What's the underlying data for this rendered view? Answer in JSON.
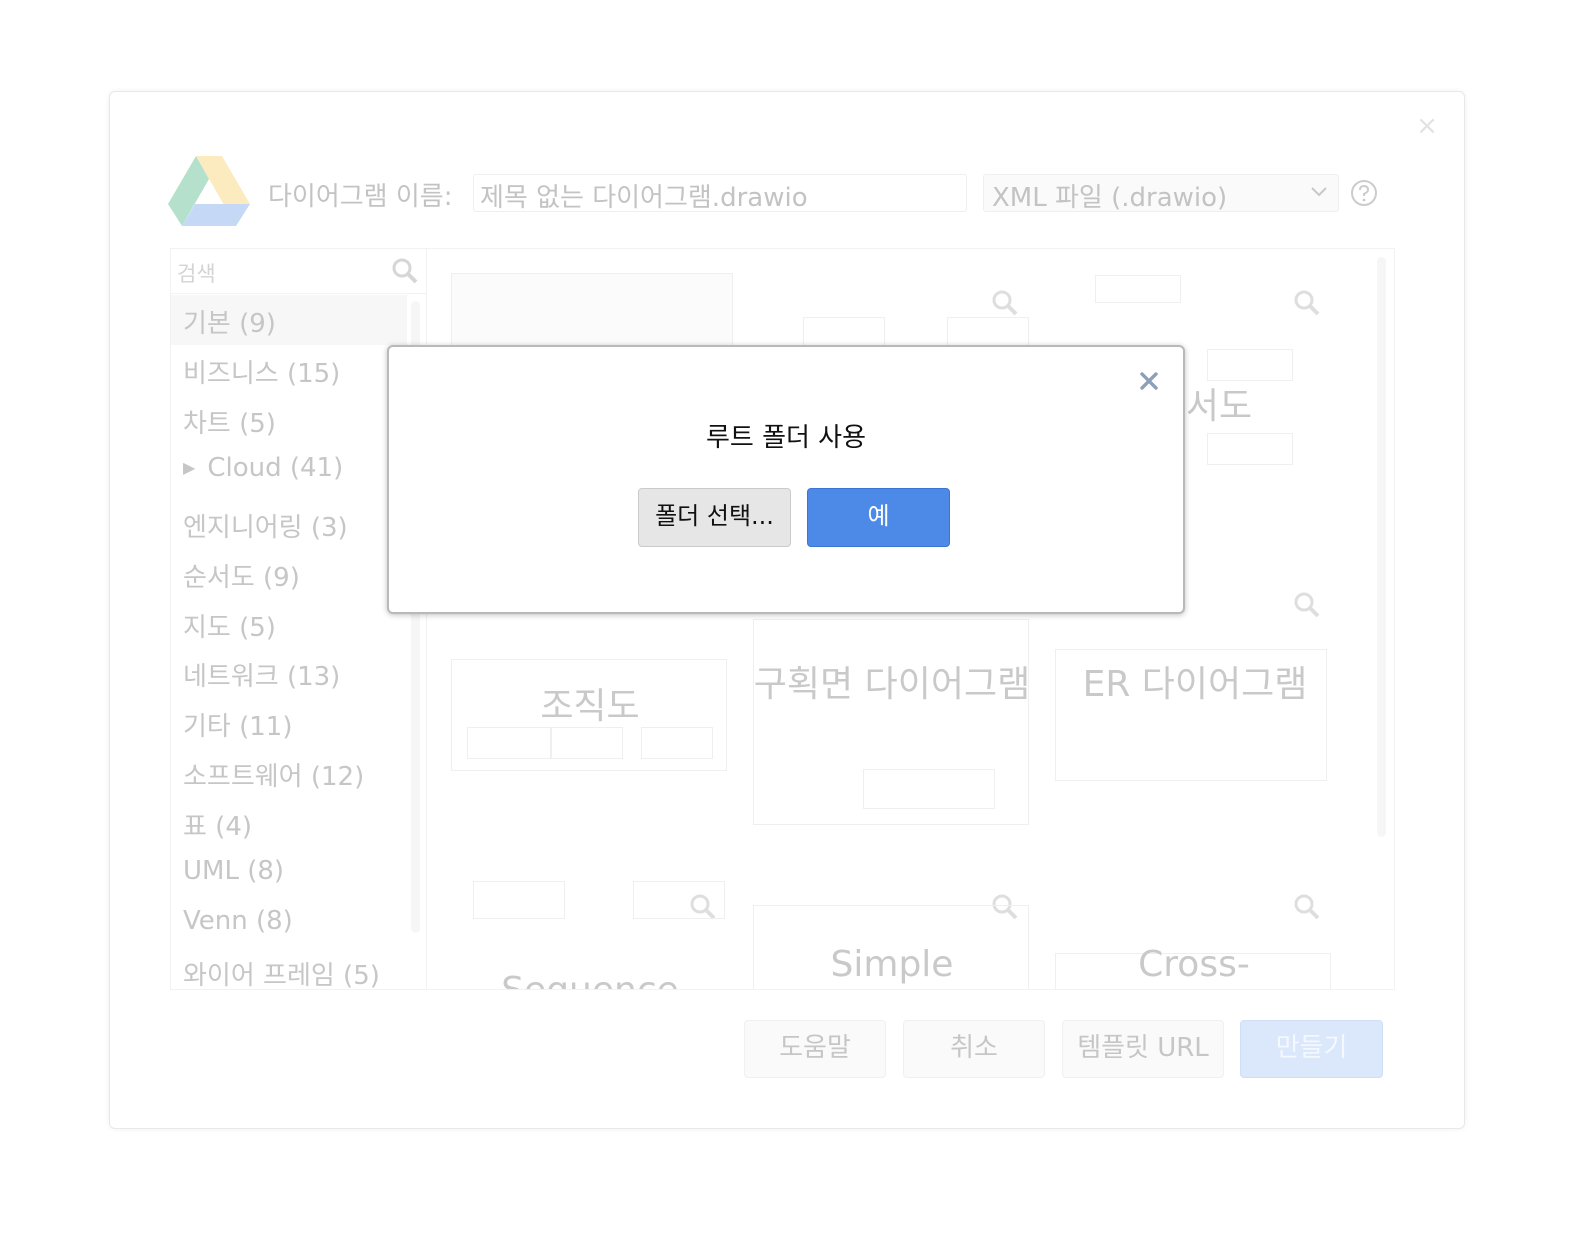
{
  "background_dialog": {
    "close_symbol": "×",
    "name_label": "다이어그램 이름:",
    "name_value": "제목 없는 다이어그램.drawio",
    "format_value": "XML 파일 (.drawio)",
    "search_placeholder": "검색",
    "categories": [
      "기본 (9)",
      "비즈니스 (15)",
      "차트 (5)",
      "Cloud (41)",
      "엔지니어링 (3)",
      "순서도 (9)",
      "지도 (5)",
      "네트워크 (13)",
      "기타 (11)",
      "소프트웨어 (12)",
      "표 (4)",
      "UML (8)",
      "Venn (8)",
      "와이어 프레임 (5)"
    ],
    "templates": [
      "서도",
      "조직도",
      "구획면 다이어그램",
      "ER 다이어그램",
      "Sequence",
      "Simple",
      "Cross-"
    ],
    "buttons": {
      "help": "도움말",
      "cancel": "취소",
      "template_url": "템플릿 URL",
      "create": "만들기"
    }
  },
  "modal": {
    "title": "루트 폴더 사용",
    "folder_button": "폴더 선택...",
    "yes_button": "예"
  },
  "colors": {
    "primary": "#4d8ae8",
    "primary_faded": "#dbe7fb"
  }
}
